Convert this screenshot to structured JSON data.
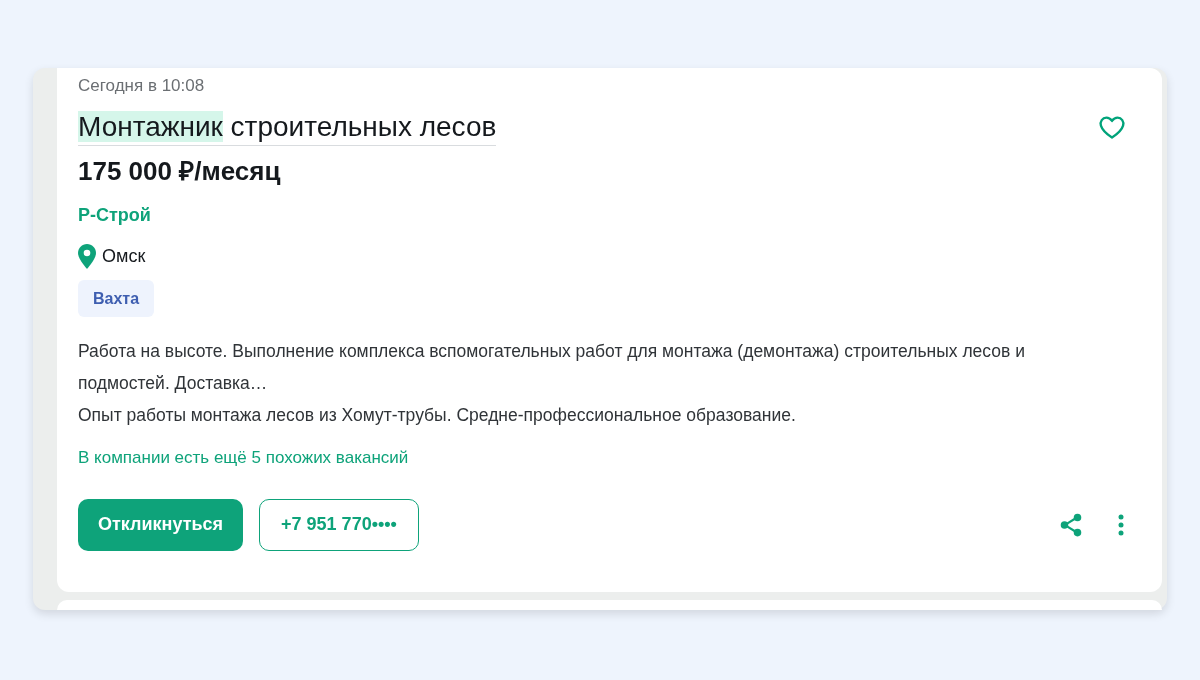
{
  "vacancy": {
    "published": "Сегодня в 10:08",
    "title_parts": [
      {
        "text": "Монтажник",
        "highlighted": true
      },
      {
        "text": " строительных лесов",
        "highlighted": false
      }
    ],
    "favorite": false,
    "salary": "175 000 ₽/месяц",
    "company": "Р-Строй",
    "city": "Омск",
    "tags": [
      "Вахта"
    ],
    "description": [
      "Работа на высоте. Выполнение комплекса вспомогательных работ для монтажа (демонтажа) строительных лесов и подмостей. Доставка…",
      "Опыт работы монтажа лесов из Хомут-трубы. Средне-профессиональное образование."
    ],
    "similar_link": "В компании есть ещё 5 похожих вакансий",
    "respond_button": "Откликнуться",
    "phone_button": "+7 951 770••••"
  }
}
